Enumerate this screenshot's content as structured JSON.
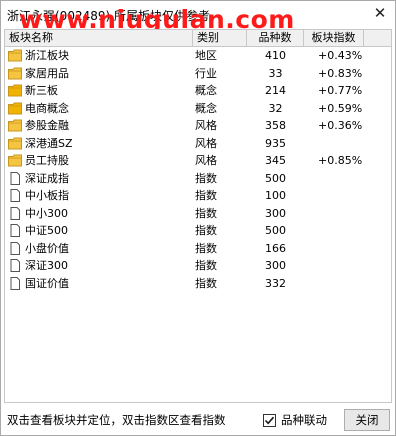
{
  "window": {
    "title": "浙江永强(002489) 所属板块仅供参考",
    "watermark": "www.niugulan.com"
  },
  "columns": [
    "板块名称",
    "类别",
    "品种数",
    "板块指数"
  ],
  "rows": [
    {
      "name": "浙江板块",
      "category": "地区",
      "count": "410",
      "index": "+0.43%",
      "icon": "folder-icon",
      "selected": false
    },
    {
      "name": "家居用品",
      "category": "行业",
      "count": "33",
      "index": "+0.83%",
      "icon": "folder-icon",
      "selected": false
    },
    {
      "name": "新三板",
      "category": "概念",
      "count": "214",
      "index": "+0.77%",
      "icon": "folder-icon-filled",
      "selected": true
    },
    {
      "name": "电商概念",
      "category": "概念",
      "count": "32",
      "index": "+0.59%",
      "icon": "folder-icon-filled",
      "selected": true
    },
    {
      "name": "参股金融",
      "category": "风格",
      "count": "358",
      "index": "+0.36%",
      "icon": "folder-icon",
      "selected": false
    },
    {
      "name": "深港通SZ",
      "category": "风格",
      "count": "935",
      "index": "",
      "icon": "folder-icon",
      "selected": false
    },
    {
      "name": "员工持股",
      "category": "风格",
      "count": "345",
      "index": "+0.85%",
      "icon": "folder-icon",
      "selected": false
    },
    {
      "name": "深证成指",
      "category": "指数",
      "count": "500",
      "index": "",
      "icon": "document-icon",
      "selected": false
    },
    {
      "name": "中小板指",
      "category": "指数",
      "count": "100",
      "index": "",
      "icon": "document-icon",
      "selected": false
    },
    {
      "name": "中小300",
      "category": "指数",
      "count": "300",
      "index": "",
      "icon": "document-icon",
      "selected": false
    },
    {
      "name": "中证500",
      "category": "指数",
      "count": "500",
      "index": "",
      "icon": "document-icon",
      "selected": false
    },
    {
      "name": "小盘价值",
      "category": "指数",
      "count": "166",
      "index": "",
      "icon": "document-icon",
      "selected": false
    },
    {
      "name": "深证300",
      "category": "指数",
      "count": "300",
      "index": "",
      "icon": "document-icon",
      "selected": false
    },
    {
      "name": "国证价值",
      "category": "指数",
      "count": "332",
      "index": "",
      "icon": "document-icon",
      "selected": false
    }
  ],
  "status": {
    "hint": "双击查看板块并定位，双击指数区查看指数",
    "linkage_label": "品种联动",
    "linkage_checked": true,
    "close_label": "关闭"
  },
  "colors": {
    "watermark": "#ff1a1a",
    "folder": "#f5c542",
    "folder_filled": "#f0b400",
    "folder_border": "#c8961e"
  }
}
